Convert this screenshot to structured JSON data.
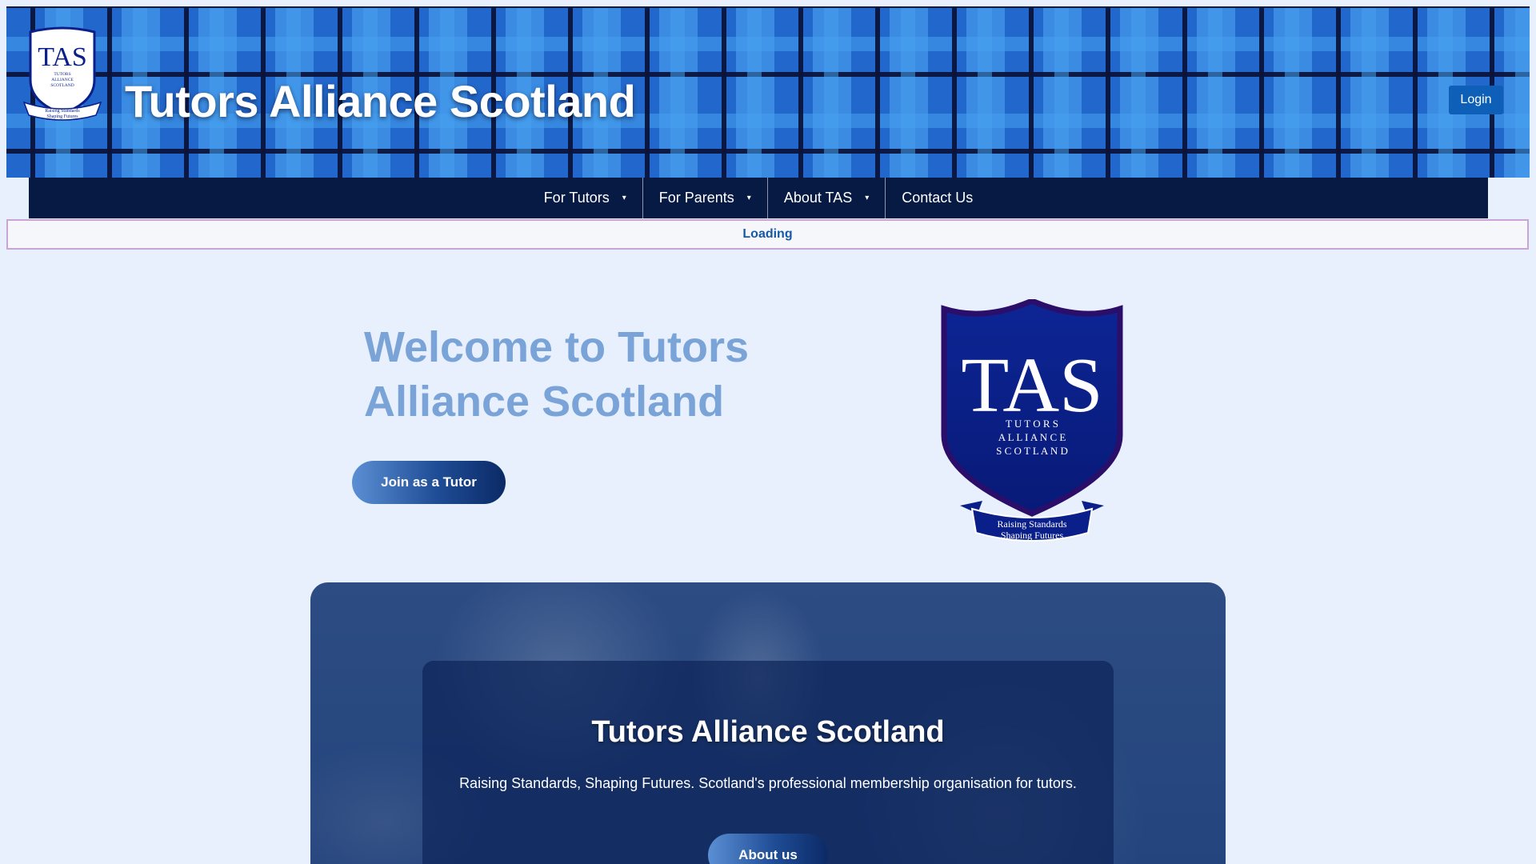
{
  "header": {
    "site_title": "Tutors Alliance Scotland",
    "login_label": "Login",
    "logo": {
      "initials": "TAS",
      "words": [
        "TUTORS",
        "ALLIANCE",
        "SCOTLAND"
      ],
      "ribbon": [
        "Raising Standards",
        "Shaping Futures"
      ]
    }
  },
  "nav": {
    "items": [
      {
        "label": "For Tutors",
        "has_dropdown": true
      },
      {
        "label": "For Parents",
        "has_dropdown": true
      },
      {
        "label": "About TAS",
        "has_dropdown": true
      },
      {
        "label": "Contact Us",
        "has_dropdown": false
      }
    ],
    "caret": "▾"
  },
  "status": {
    "loading_text": "Loading"
  },
  "hero": {
    "title": "Welcome to Tutors Alliance Scotland",
    "cta_label": "Join as a Tutor",
    "crest": {
      "initials": "TAS",
      "words": [
        "T U T O R S",
        "A L L I A N C E",
        "S C O T L A N D"
      ],
      "ribbon": [
        "Raising Standards",
        "Shaping Futures"
      ]
    }
  },
  "banner": {
    "title": "Tutors Alliance Scotland",
    "text": "Raising Standards, Shaping Futures. Scotland's professional membership organisation for tutors.",
    "cta_label": "About us"
  },
  "colors": {
    "page_bg": "#e8f0fd",
    "nav_bg": "#061a44",
    "login_bg": "#0d5fb8",
    "hero_title": "#7aa4d8",
    "crest_blue": "#0a1f8a",
    "loading_border": "#c9a4d6",
    "loading_text": "#1658a8"
  }
}
